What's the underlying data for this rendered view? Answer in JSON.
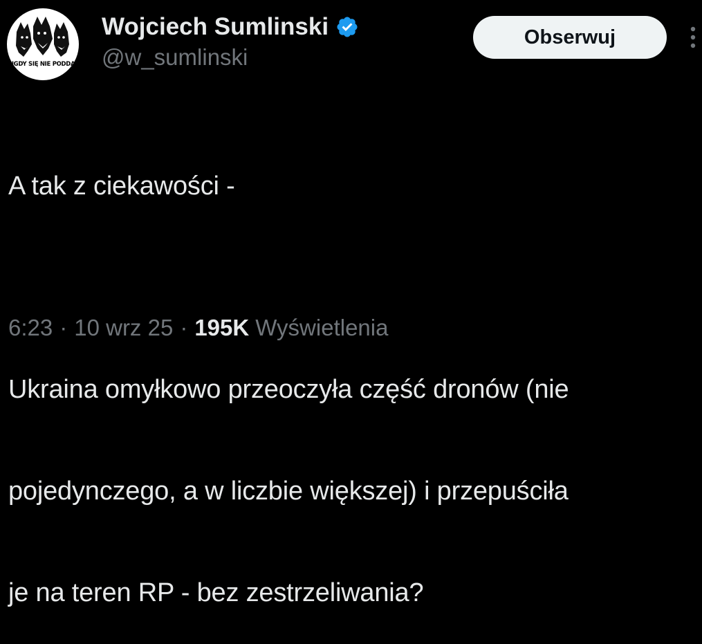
{
  "author": {
    "display_name": "Wojciech Sumlinski",
    "handle": "@w_sumlinski",
    "avatar_text": "NIGDY SIĘ NIE PODDAWAJ",
    "verified_color": "#1d9bf0"
  },
  "actions": {
    "follow_label": "Obserwuj",
    "more_icon": "more-vertical-icon"
  },
  "tweet": {
    "lines": [
      "A tak z ciekawości -",
      "",
      "Ukraina omyłkowo przeoczyła część dronów (nie",
      "pojedynczego, a w liczbie większej) i przepuściła",
      "je na teren RP - bez zestrzeliwania?"
    ]
  },
  "meta": {
    "time": "6:23",
    "date": "10 wrz 25",
    "separator": "·",
    "views_count": "195K",
    "views_label": "Wyświetlenia"
  },
  "colors": {
    "background": "#000000",
    "text_primary": "#e7e9ea",
    "text_secondary": "#71767b",
    "button_bg": "#eff3f4",
    "button_text": "#0f1419"
  }
}
